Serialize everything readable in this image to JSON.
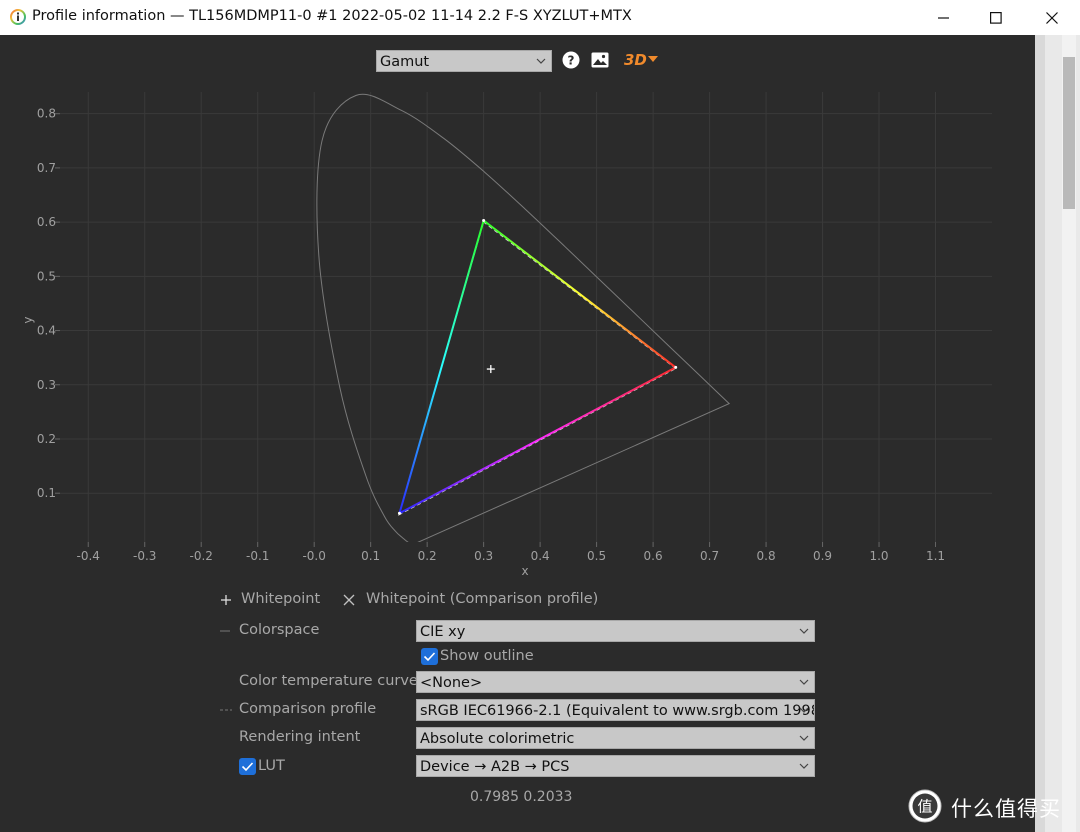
{
  "window": {
    "title": "Profile information — TL156MDMP11-0 #1 2022-05-02 11-14 2.2 F-S XYZLUT+MTX"
  },
  "toolbar": {
    "view_select": "Gamut",
    "help_icon": "help-icon",
    "image_icon": "image-icon",
    "three_d_label": "3D"
  },
  "chart_data": {
    "type": "scatter",
    "xlabel": "x",
    "ylabel": "y",
    "xlim": [
      -0.45,
      1.2
    ],
    "ylim": [
      0.01,
      0.84
    ],
    "grid": true,
    "x_ticks": [
      "-0.4",
      "-0.3",
      "-0.2",
      "-0.1",
      "-0.0",
      "0.1",
      "0.2",
      "0.3",
      "0.4",
      "0.5",
      "0.6",
      "0.7",
      "0.8",
      "0.9",
      "1.0",
      "1.1"
    ],
    "y_ticks": [
      "0.1",
      "0.2",
      "0.3",
      "0.4",
      "0.5",
      "0.6",
      "0.7",
      "0.8"
    ],
    "spectral_locus": [
      [
        0.1741,
        0.005
      ],
      [
        0.1738,
        0.0049
      ],
      [
        0.1644,
        0.0109
      ],
      [
        0.1566,
        0.0177
      ],
      [
        0.144,
        0.0297
      ],
      [
        0.1241,
        0.0578
      ],
      [
        0.0913,
        0.1327
      ],
      [
        0.0454,
        0.295
      ],
      [
        0.0082,
        0.5384
      ],
      [
        0.0139,
        0.7502
      ],
      [
        0.0743,
        0.8338
      ],
      [
        0.1547,
        0.8059
      ],
      [
        0.2296,
        0.7543
      ],
      [
        0.3016,
        0.6923
      ],
      [
        0.3731,
        0.6245
      ],
      [
        0.4441,
        0.5547
      ],
      [
        0.5125,
        0.4866
      ],
      [
        0.5752,
        0.4242
      ],
      [
        0.627,
        0.3725
      ],
      [
        0.6658,
        0.334
      ],
      [
        0.6915,
        0.3083
      ],
      [
        0.7347,
        0.2653
      ]
    ],
    "profile_gamut": {
      "red": [
        0.64,
        0.332
      ],
      "green": [
        0.3,
        0.603
      ],
      "blue": [
        0.151,
        0.063
      ]
    },
    "comparison_gamut": {
      "red": [
        0.64,
        0.33
      ],
      "green": [
        0.3,
        0.6
      ],
      "blue": [
        0.15,
        0.06
      ]
    },
    "whitepoint": [
      0.3127,
      0.329
    ]
  },
  "legend": {
    "whitepoint": "Whitepoint",
    "whitepoint_comparison": "Whitepoint (Comparison profile)"
  },
  "controls": {
    "colorspace_label": "Colorspace",
    "colorspace_value": "CIE xy",
    "show_outline_label": "Show outline",
    "show_outline_checked": true,
    "color_temp_label": "Color temperature curve",
    "color_temp_value": "<None>",
    "comparison_label": "Comparison profile",
    "comparison_value": "sRGB IEC61966-2.1 (Equivalent to www.srgb.com 1998",
    "intent_label": "Rendering intent",
    "intent_value": "Absolute colorimetric",
    "lut_label": "LUT",
    "lut_checked": true,
    "lut_value": "Device → A2B → PCS"
  },
  "readout": "0.7985 0.2033",
  "watermark": "什么值得买",
  "colors": {
    "background": "#2b2b2b",
    "grid": "#3a3a3a",
    "locus": "#7a7a7a",
    "checkbox": "#1e6fd9",
    "three_d_accent": "#f08a2c"
  }
}
